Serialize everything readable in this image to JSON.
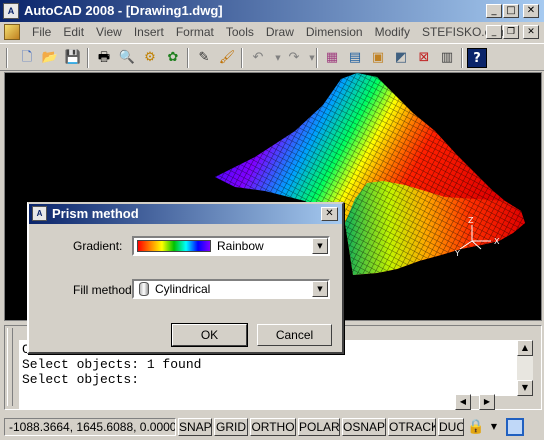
{
  "window": {
    "title": "AutoCAD 2008 - [Drawing1.dwg]",
    "app_icon_text": "A",
    "buttons": {
      "minimize": "_",
      "maximize": "□",
      "close": "✕"
    }
  },
  "menubar": {
    "items": [
      "File",
      "Edit",
      "View",
      "Insert",
      "Format",
      "Tools",
      "Draw",
      "Dimension",
      "Modify",
      "STEFISKO.com"
    ],
    "mdi_buttons": {
      "minimize": "_",
      "restore": "❐",
      "close": "✕"
    }
  },
  "toolbar": {
    "help_label": "?"
  },
  "drawing": {
    "ucs": {
      "x": "X",
      "y": "Y",
      "z": "Z"
    }
  },
  "command": {
    "lines": [
      "C",
      "Select objects: 1 found",
      "Select objects:"
    ]
  },
  "status": {
    "coords": "-1088.3664, 1645.6088, 0.0000",
    "buttons": [
      "SNAP",
      "GRID",
      "ORTHO",
      "POLAR",
      "OSNAP",
      "OTRACK",
      "DUC"
    ]
  },
  "dialog": {
    "title": "Prism method",
    "icon_text": "A",
    "close": "✕",
    "gradient_label": "Gradient:",
    "gradient_value": "Rainbow",
    "fill_label": "Fill method:",
    "fill_value": "Cylindrical",
    "ok_label": "OK",
    "cancel_label": "Cancel"
  },
  "colors": {
    "title_start": "#0a246a",
    "title_end": "#a6caf0",
    "chrome": "#d4d0c8",
    "viewport": "#000000"
  }
}
